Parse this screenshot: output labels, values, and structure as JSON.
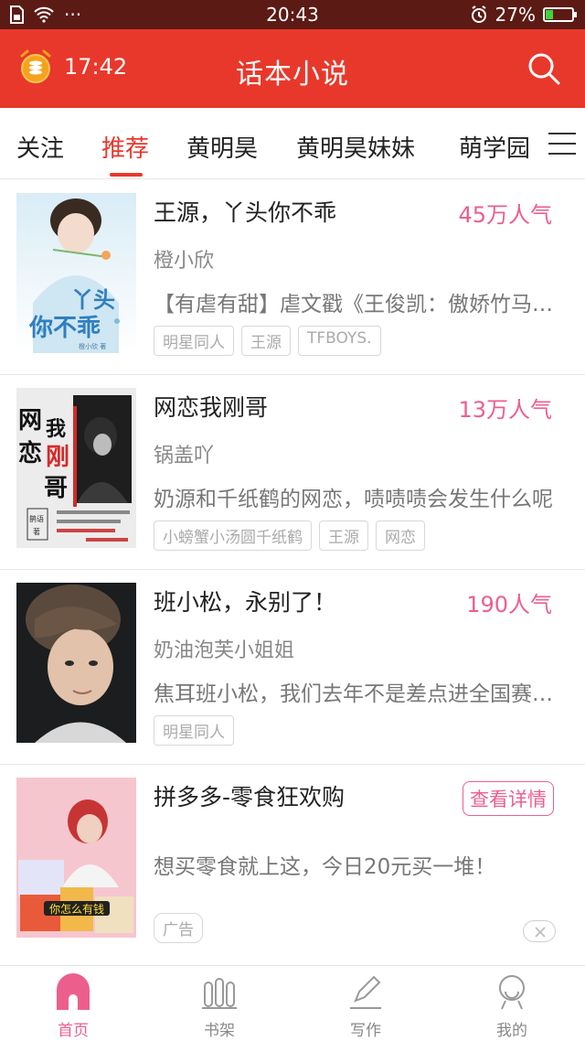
{
  "status_bar": {
    "time": "20:43",
    "battery": "27%",
    "dots": "···",
    "battery_level": 0.27,
    "icons": [
      "sim-icon",
      "wifi-icon",
      "alarm-icon",
      "battery-icon"
    ]
  },
  "header": {
    "timer": "17:42",
    "title": "话本小说",
    "icons": [
      "alarm-clock-coin-icon",
      "search-icon"
    ]
  },
  "tabs": [
    {
      "label": "关注"
    },
    {
      "label": "推荐",
      "active": true
    },
    {
      "label": "黄明昊"
    },
    {
      "label": "黄明昊妹妹"
    },
    {
      "label": "萌学园"
    }
  ],
  "books": [
    {
      "title": "王源，丫头你不乖",
      "popularity": "45万人气",
      "author": "橙小欣",
      "description": "【有虐有甜】虐文戳《王俊凯：傲娇竹马，我不是你的替身》",
      "tags": [
        "明星同人",
        "王源",
        "TFBOYS."
      ],
      "cover_text": [
        "丫头",
        "你不乖",
        "橙小欣 著"
      ]
    },
    {
      "title": "网恋我刚哥",
      "popularity": "13万人气",
      "author": "锅盖吖",
      "description": "奶源和千纸鹤的网恋，啧啧啧会发生什么呢",
      "tags": [
        "小螃蟹小汤圆千纸鹤",
        "王源",
        "网恋"
      ],
      "cover_text": [
        "网",
        "恋",
        "我",
        "刚",
        "哥",
        "鹊语",
        "著"
      ]
    },
    {
      "title": "班小松，永别了！",
      "popularity": "190人气",
      "author": "奶油泡芙小姐姐",
      "description": "焦耳班小松，我们去年不是差点进全国赛了吗",
      "tags": [
        "明星同人"
      ],
      "cover_text": []
    }
  ],
  "ad": {
    "title": "拼多多-零食狂欢购",
    "detail_button": "查看详情",
    "description": "想买零食就上这，今日20元买一堆！",
    "badge": "广告",
    "cover_text": "你怎么有钱"
  },
  "bottom_nav": [
    {
      "label": "首页",
      "icon": "home-icon",
      "active": true
    },
    {
      "label": "书架",
      "icon": "bookshelf-icon"
    },
    {
      "label": "写作",
      "icon": "pen-icon"
    },
    {
      "label": "我的",
      "icon": "profile-icon"
    }
  ],
  "colors": {
    "header_red": "#e8382b",
    "status_bar": "#5c1a14",
    "popularity_pink": "#ec5f8c",
    "active_nav_pink": "#ec5f8c"
  }
}
